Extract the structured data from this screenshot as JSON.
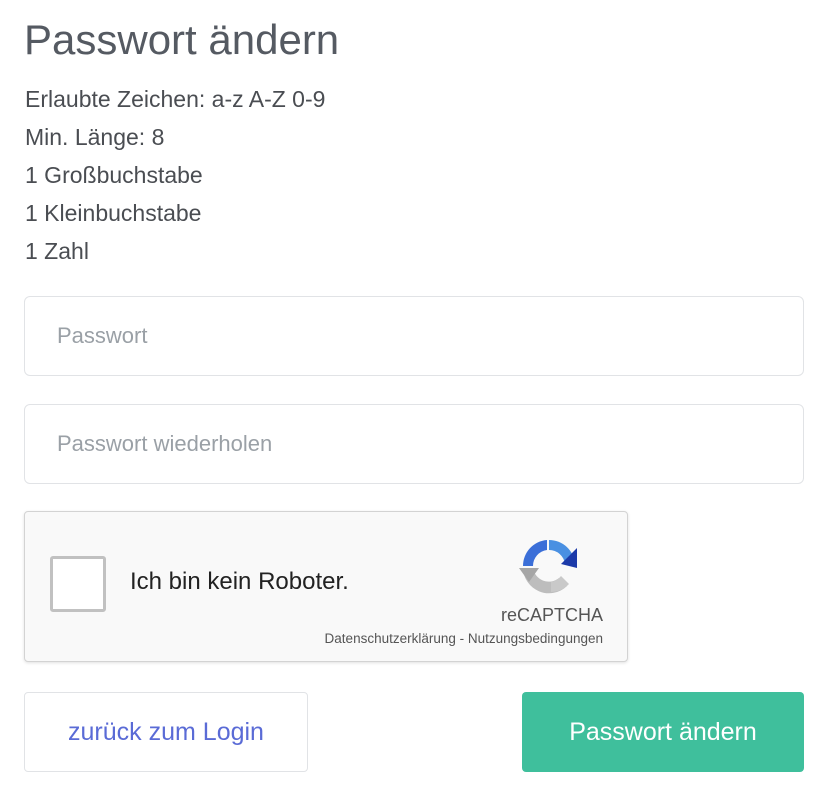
{
  "page": {
    "title": "Passwort ändern"
  },
  "rules": [
    "Erlaubte Zeichen: a-z A-Z 0-9",
    "Min. Länge: 8",
    "1 Großbuchstabe",
    "1 Kleinbuchstabe",
    "1 Zahl"
  ],
  "form": {
    "password_placeholder": "Passwort",
    "password_value": "",
    "password_repeat_placeholder": "Passwort wiederholen",
    "password_repeat_value": ""
  },
  "recaptcha": {
    "label": "Ich bin kein Roboter.",
    "brand": "reCAPTCHA",
    "privacy": "Datenschutzerklärung",
    "separator": " - ",
    "terms": "Nutzungsbedingungen",
    "checked": false,
    "logo_icon": "recaptcha-logo-icon"
  },
  "buttons": {
    "back_label": "zurück zum Login",
    "submit_label": "Passwort ändern"
  },
  "colors": {
    "accent": "#3fbf9c",
    "link": "#5a6bd6",
    "title": "#555a62",
    "text": "#4a4d52"
  }
}
